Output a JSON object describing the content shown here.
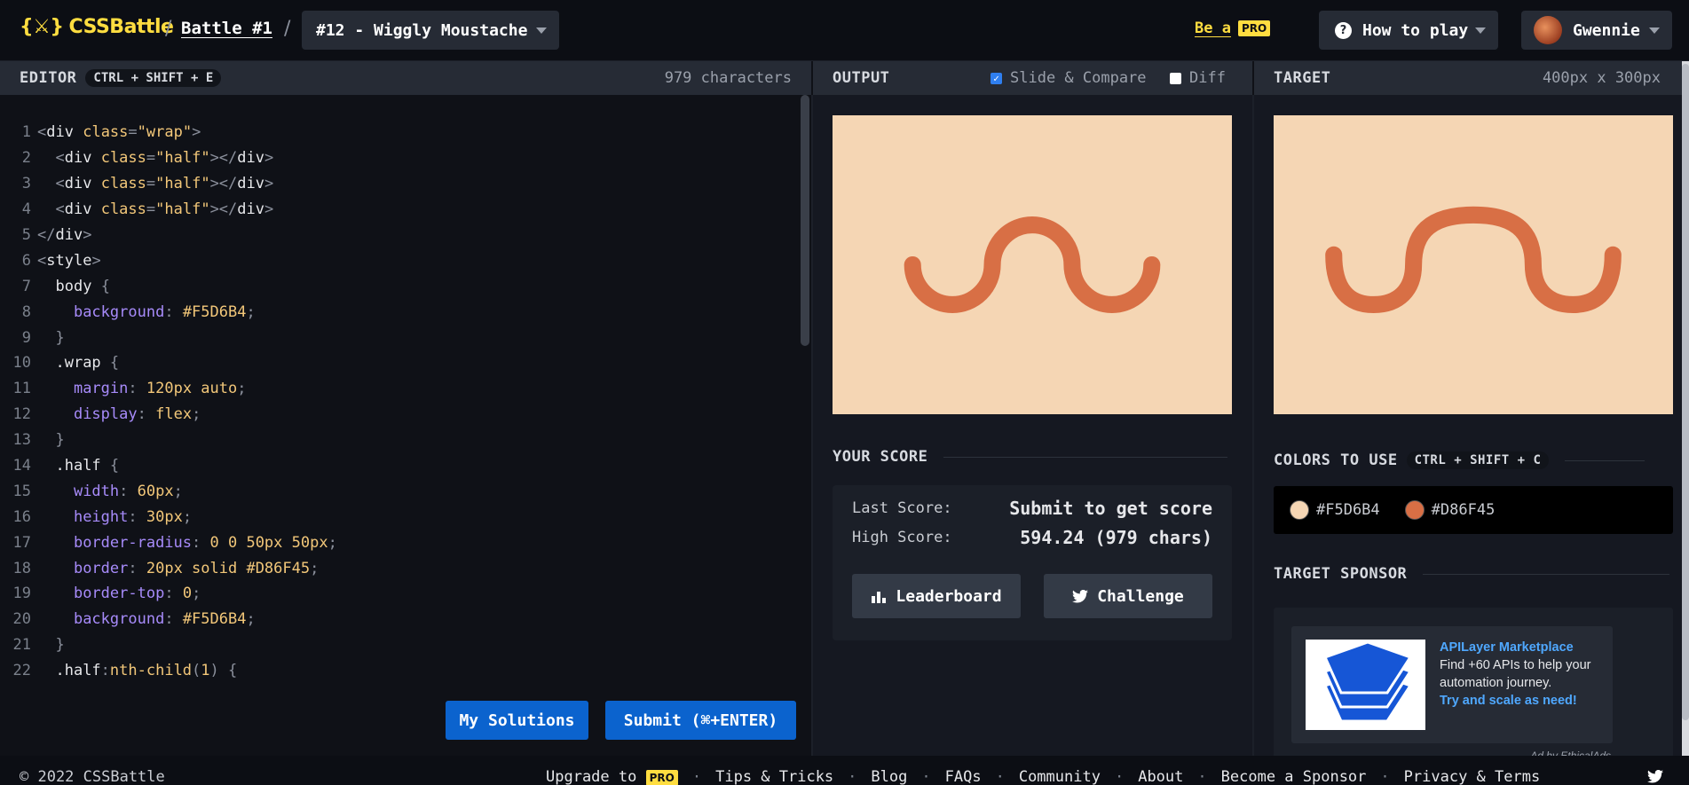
{
  "header": {
    "logo_text": "CSSBattle",
    "logo_mark": "{⚔}",
    "sep1": "/",
    "sep2": "/",
    "battle": "Battle #1",
    "target_select": "#12 - Wiggly Moustache",
    "be_a": "Be a",
    "pro": "PRO",
    "how_to_play": "How to play",
    "username": "Gwennie"
  },
  "editor": {
    "title": "EDITOR",
    "shortcut": "CTRL + SHIFT + E",
    "char_count": "979 characters",
    "my_solutions": "My Solutions",
    "submit": "Submit (⌘+ENTER)"
  },
  "output": {
    "title": "OUTPUT",
    "slide_compare": "Slide & Compare",
    "slide_compare_checked": true,
    "diff": "Diff",
    "diff_checked": false,
    "your_score": "YOUR SCORE",
    "last_score_label": "Last Score:",
    "last_score_value": "Submit to get score",
    "high_score_label": "High Score:",
    "high_score_value": "594.24 (979 chars)",
    "leaderboard": "Leaderboard",
    "challenge": "Challenge"
  },
  "target": {
    "title": "TARGET",
    "dimensions": "400px x 300px",
    "colors_title": "COLORS TO USE",
    "colors_shortcut": "CTRL + SHIFT + C",
    "colors": [
      {
        "hex": "#F5D6B4",
        "label": "#F5D6B4"
      },
      {
        "hex": "#D86F45",
        "label": "#D86F45"
      }
    ],
    "sponsor_title": "TARGET SPONSOR",
    "ad_brand": "APILayer Marketplace",
    "ad_body": "Find +60 APIs to help your automation journey.",
    "ad_cta": "Try and scale as need!",
    "ad_by": "Ad by EthicalAds"
  },
  "theme": {
    "background": "#F5D6B4",
    "stroke": "#D86F45",
    "accent_yellow": "#ffdd40",
    "button_blue": "#0b63ce"
  },
  "footer": {
    "copyright": "© 2022 CSSBattle",
    "links": [
      "Upgrade to",
      "Tips & Tricks",
      "Blog",
      "FAQs",
      "Community",
      "About",
      "Become a Sponsor",
      "Privacy & Terms"
    ],
    "pro": "PRO"
  }
}
